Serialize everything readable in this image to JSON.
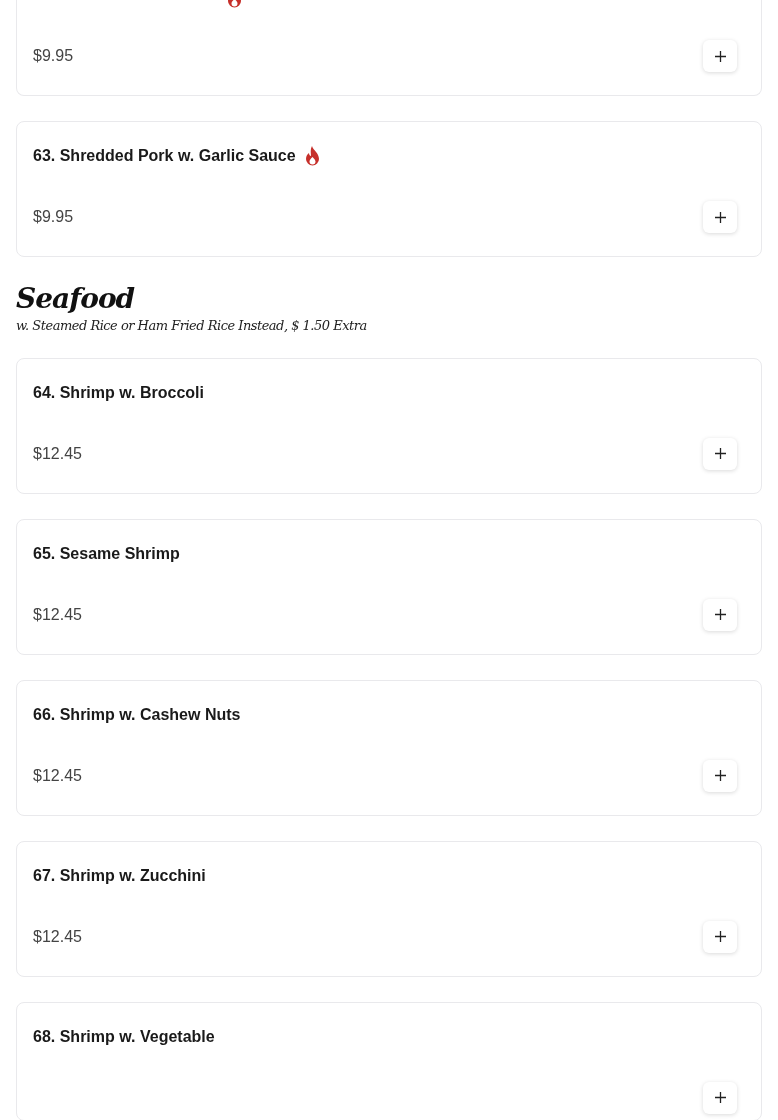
{
  "sections": [
    {
      "items": [
        {
          "price": "$9.95",
          "spicy": true
        },
        {
          "name": "63. Shredded Pork w. Garlic Sauce",
          "spicy": true,
          "price": "$9.95"
        }
      ]
    },
    {
      "title": "Seafood",
      "subtitle": "w. Steamed Rice or Ham Fried Rice Instead, $ 1.50 Extra",
      "items": [
        {
          "name": "64. Shrimp w. Broccoli",
          "spicy": false,
          "price": "$12.45"
        },
        {
          "name": "65. Sesame Shrimp",
          "spicy": false,
          "price": "$12.45"
        },
        {
          "name": "66. Shrimp w. Cashew Nuts",
          "spicy": false,
          "price": "$12.45"
        },
        {
          "name": "67. Shrimp w. Zucchini",
          "spicy": false,
          "price": "$12.45"
        },
        {
          "name": "68. Shrimp w. Vegetable",
          "spicy": false
        }
      ]
    }
  ]
}
